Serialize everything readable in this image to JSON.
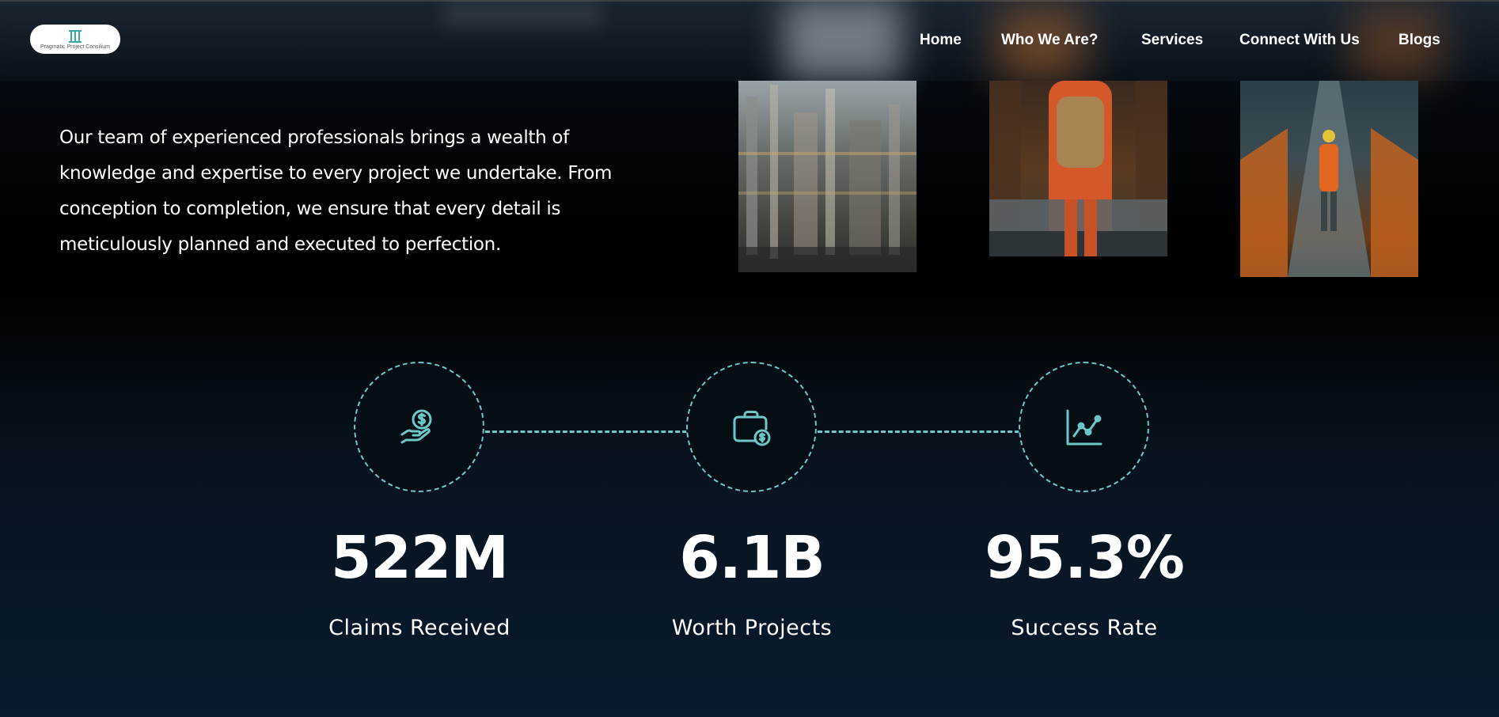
{
  "header": {
    "logo_text": "Pragmatic Project Consilium",
    "nav": [
      {
        "label": "Home"
      },
      {
        "label": "Who We Are?"
      },
      {
        "label": "Services"
      },
      {
        "label": "Connect With Us"
      },
      {
        "label": "Blogs"
      }
    ]
  },
  "intro": {
    "paragraph": "Our team of experienced professionals brings a wealth of knowledge and expertise to every project we undertake. From conception to completion, we ensure that every detail is meticulously planned and executed to perfection."
  },
  "gallery": [
    {
      "icon": "refinery-photo"
    },
    {
      "icon": "worker-backpack-photo"
    },
    {
      "icon": "worker-walkway-photo"
    }
  ],
  "stats": [
    {
      "value": "522M",
      "label": "Claims Received",
      "icon": "hand-coin-icon"
    },
    {
      "value": "6.1B",
      "label": "Worth Projects",
      "icon": "briefcase-dollar-icon"
    },
    {
      "value": "95.3%",
      "label": "Success Rate",
      "icon": "chart-growth-icon"
    }
  ],
  "colors": {
    "accent": "#6cc7c6",
    "background_top": "#000000",
    "background_bottom": "#0a1b2e"
  }
}
